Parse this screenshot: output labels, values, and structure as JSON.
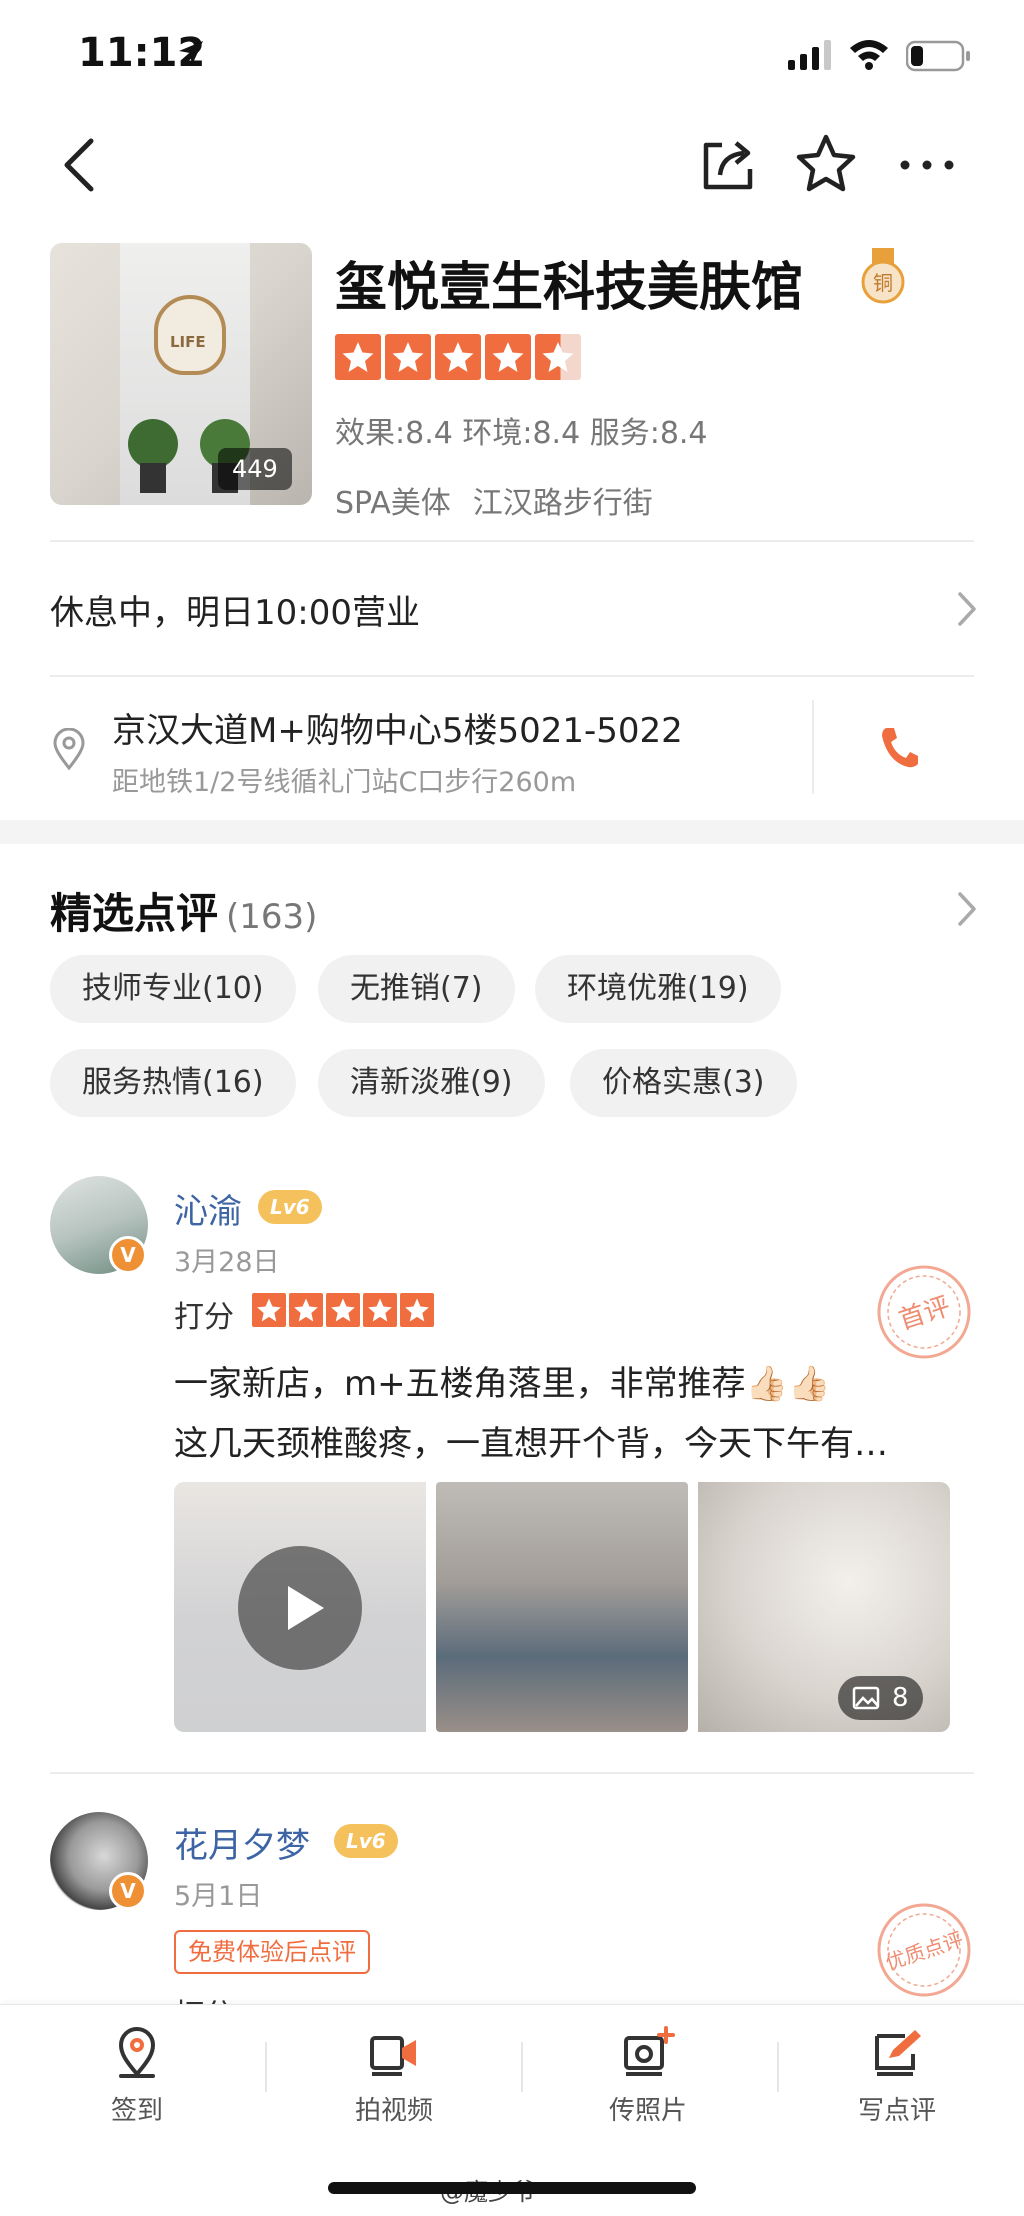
{
  "status_bar": {
    "time": "11:12"
  },
  "shop": {
    "name": "玺悦壹生科技美肤馆",
    "medal_text": "铜",
    "photo_count": "449",
    "photo_logo_text": "LIFE",
    "rating_stars": 4.5,
    "scores": "效果:8.4 环境:8.4 服务:8.4",
    "category": "SPA美体",
    "area": "江汉路步行街",
    "hours": "休息中，明日10:00营业",
    "address": "京汉大道M+购物中心5楼5021-5022",
    "address_sub": "距地铁1/2号线循礼门站C口步行260m"
  },
  "reviews": {
    "title": "精选点评",
    "count": "(163)",
    "tags": [
      "技师专业(10)",
      "无推销(7)",
      "环境优雅(19)",
      "服务热情(16)",
      "清新淡雅(9)",
      "价格实惠(3)"
    ],
    "items": [
      {
        "username": "沁渝",
        "level": "Lv6",
        "date": "3月28日",
        "rate_label": "打分",
        "stars": 5,
        "stamp": "首评",
        "text_line1": "一家新店，m+五楼角落里，非常推荐👍🏻👍🏻",
        "text_line2": "这几天颈椎酸疼，一直想开个背，今天下午有…",
        "photo_count": "8"
      },
      {
        "username": "花月夕梦",
        "level": "Lv6",
        "date": "5月1日",
        "free_tag": "免费体验后点评",
        "rate_label": "打分",
        "stamp": "优质点评"
      }
    ]
  },
  "tabbar": {
    "items": [
      {
        "label": "签到",
        "icon": "checkin-pin-icon"
      },
      {
        "label": "拍视频",
        "icon": "video-camera-icon"
      },
      {
        "label": "传照片",
        "icon": "upload-photo-icon"
      },
      {
        "label": "写点评",
        "icon": "write-review-icon"
      }
    ]
  },
  "watermark": "@魔少爷",
  "colors": {
    "accent": "#f06d3f",
    "username": "#3d64a4",
    "level_badge": "#f5c15c"
  }
}
